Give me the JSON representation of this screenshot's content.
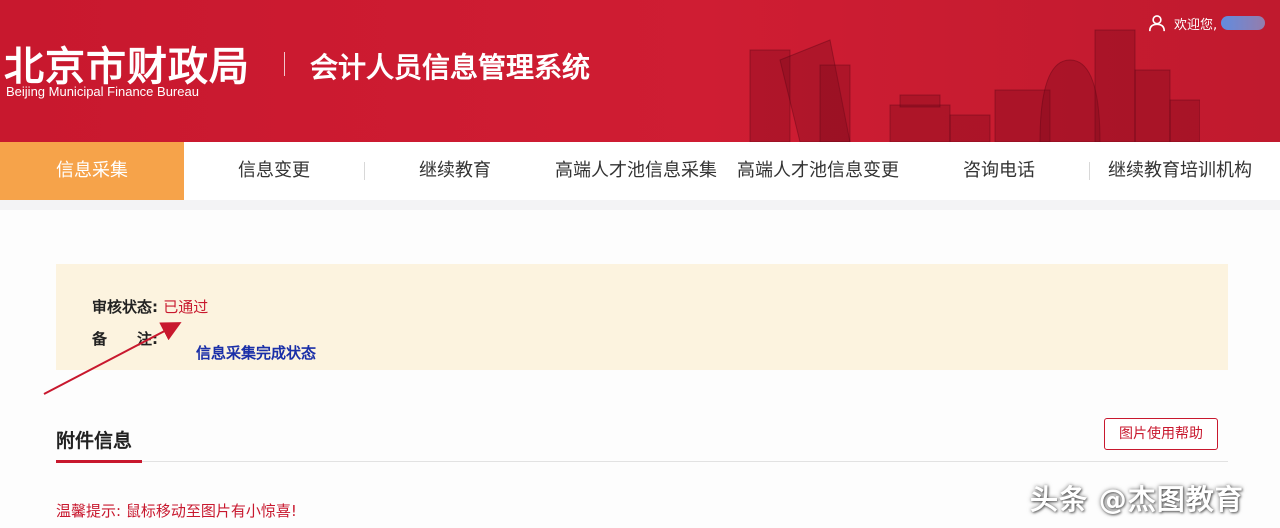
{
  "header": {
    "org_name_cn": "北京市财政局",
    "org_name_en": "Beijing Municipal Finance Bureau",
    "system_title": "会计人员信息管理系统",
    "welcome": "欢迎您,"
  },
  "nav": {
    "items": [
      {
        "label": "信息采集",
        "active": true
      },
      {
        "label": "信息变更"
      },
      {
        "label": "继续教育"
      },
      {
        "label": "高端人才池信息采集"
      },
      {
        "label": "高端人才池信息变更"
      },
      {
        "label": "咨询电话"
      },
      {
        "label": "继续教育培训机构"
      }
    ]
  },
  "status": {
    "review_label": "审核状态:",
    "review_value": "已通过",
    "note_label": "备　　注:",
    "annotation": "信息采集完成状态"
  },
  "attachments": {
    "title": "附件信息",
    "help_button": "图片使用帮助",
    "tip": "温馨提示: 鼠标移动至图片有小惊喜!"
  },
  "watermark": "头条 @杰图教育",
  "colors": {
    "brand_red": "#c8182e",
    "nav_active": "#f6a34a",
    "status_bg": "#fcf3df",
    "annotation_blue": "#1a2fa8"
  }
}
